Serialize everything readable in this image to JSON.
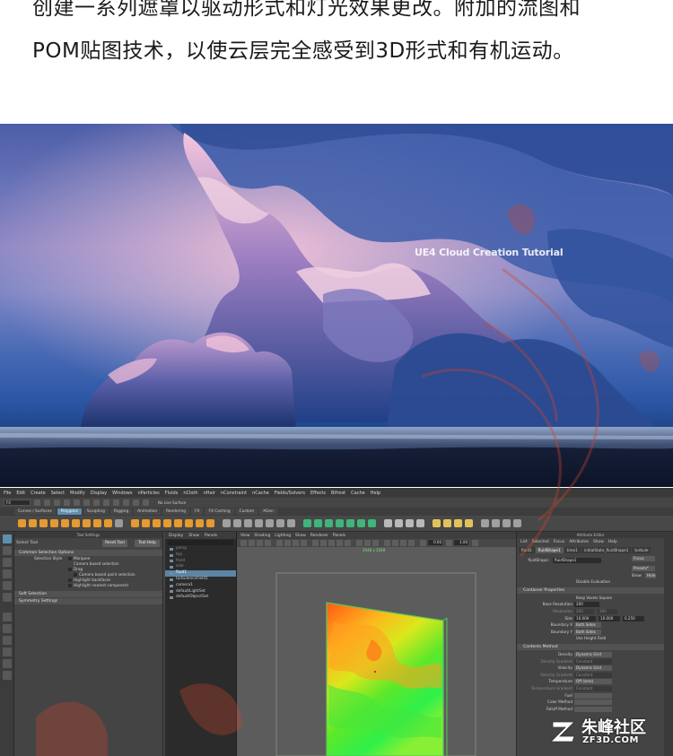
{
  "article": {
    "line1": "创建一系列遮罩以驱动形式和灯光效果更改。附加的流图和",
    "line2": "POM贴图技术，以使云层完全感受到3D形式和有机运动。"
  },
  "render": {
    "caption": "UE4 Cloud Creation Tutorial"
  },
  "maya": {
    "menus": [
      "File",
      "Edit",
      "Create",
      "Select",
      "Modify",
      "Display",
      "Windows",
      "nParticles",
      "Fluids",
      "nCloth",
      "nHair",
      "nConstraint",
      "nCache",
      "Fields/Solvers",
      "Effects",
      "Bifrost",
      "Cache",
      "Help"
    ],
    "status": {
      "mode": "FX",
      "no_live_surface": "No Live Surface"
    },
    "shelf_tabs": [
      "Curves / Surfaces",
      "Polygons",
      "Sculpting",
      "Rigging",
      "Animation",
      "Rendering",
      "FX",
      "FX Caching",
      "Custom",
      "XGen"
    ],
    "active_shelf_tab": "Polygons",
    "tool_settings": {
      "panel_title": "Tool Settings",
      "tool_name": "Select Tool",
      "reset_button": "Reset Tool",
      "help_button": "Tool Help",
      "section_common": "Common Selection Options",
      "selection_style_label": "Selection Style",
      "options": [
        "Marquee",
        "Camera based selection",
        "Drag",
        "Camera based paint selection",
        "Highlight backfaces",
        "Highlight nearest component"
      ],
      "section_soft": "Soft Selection",
      "section_symmetry": "Symmetry Settings"
    },
    "outliner": {
      "menus": [
        "Display",
        "Show",
        "Panels"
      ],
      "items": [
        "persp",
        "top",
        "front",
        "side",
        "fluid1",
        "turbulenceField1",
        "camera1",
        "defaultLightSet",
        "defaultObjectSet"
      ],
      "selected": "fluid1"
    },
    "viewport": {
      "menus": [
        "View",
        "Shading",
        "Lighting",
        "Show",
        "Renderer",
        "Panels"
      ],
      "value_a": "0.00",
      "value_b": "1.00",
      "resolution": "2048 x 2048"
    },
    "attribute_editor": {
      "panel_title": "Attribute Editor",
      "menus": [
        "List",
        "Selected",
        "Focus",
        "Attributes",
        "Show",
        "Help"
      ],
      "tabs": [
        "fluid1",
        "fluidShape1",
        "time1",
        "initialState_fluidShape1",
        "turbule"
      ],
      "active_tab": "fluidShape1",
      "shape_label": "fluidShape:",
      "shape_value": "fluidShape1",
      "focus_button": "Focus",
      "presets_button": "Presets*",
      "show_label": "Show",
      "hide_button": "Hide",
      "disable_evaluation": "Disable Evaluation",
      "section_container": "Container Properties",
      "keep_voxels": "Keep Voxels Square",
      "base_resolution_label": "Base Resolution",
      "base_resolution": "200",
      "resolution_label": "Resolution",
      "resolution_values": [
        "200",
        "200"
      ],
      "size_label": "Size",
      "size_values": [
        "10.000",
        "10.000",
        "0.250"
      ],
      "boundary_x_label": "Boundary X",
      "boundary_x": "Both Sides",
      "boundary_y_label": "Boundary Y",
      "boundary_y": "Both Sides",
      "use_height_field": "Use Height Field",
      "section_contents": "Contents Method",
      "density_label": "Density",
      "density": "Dynamic Grid",
      "density_gradient_label": "Density Gradient",
      "density_gradient": "Constant",
      "velocity_label": "Velocity",
      "velocity": "Dynamic Grid",
      "velocity_gradient_label": "Velocity Gradient",
      "velocity_gradient": "Constant",
      "temperature_label": "Temperature",
      "temperature": "Off (zero)",
      "temperature_gradient_label": "Temperature Gradient",
      "temperature_gradient": "Constant",
      "fuel_label": "Fuel",
      "color_method_label": "Color Method",
      "falloff_method_label": "Falloff Method"
    }
  },
  "watermark": {
    "name": "朱峰社区",
    "domain": "ZF3D.COM"
  }
}
